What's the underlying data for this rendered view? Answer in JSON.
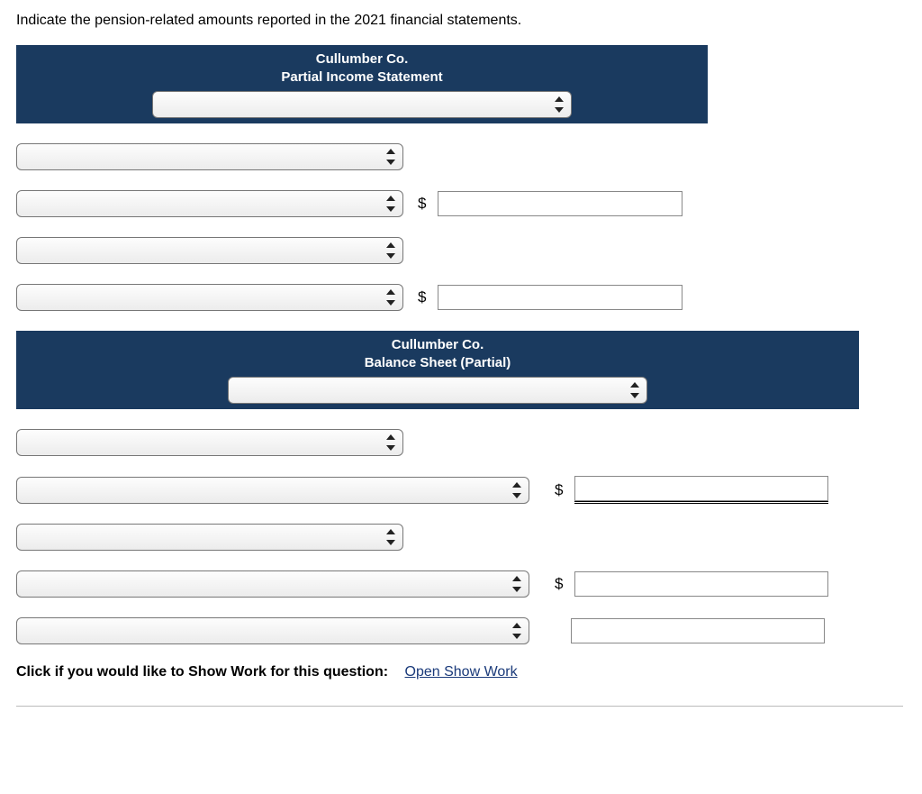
{
  "intro": "Indicate the pension-related amounts reported in the 2021 financial statements.",
  "section1": {
    "company": "Cullumber Co.",
    "title": "Partial Income Statement"
  },
  "section2": {
    "company": "Cullumber Co.",
    "title": "Balance Sheet (Partial)"
  },
  "currency": "$",
  "footer": {
    "prompt": "Click if you would like to Show Work for this question:",
    "link": "Open Show Work"
  }
}
